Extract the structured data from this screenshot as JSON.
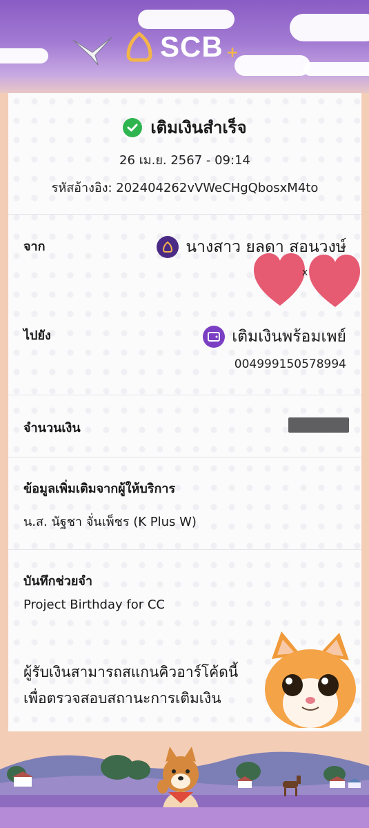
{
  "header": {
    "brand": "SCB",
    "brand_plus": "+"
  },
  "status": {
    "title": "เติมเงินสำเร็จ"
  },
  "datetime": "26 เม.ย. 2567 - 09:14",
  "reference": "รหัสอ้างอิง: 202404262vVWeCHgQbosxM4to",
  "from": {
    "label": "จาก",
    "name": "นางสาว ยลดา สอนวงษ์",
    "heart_separator": "x"
  },
  "to": {
    "label": "ไปยัง",
    "name": "เติมเงินพร้อมเพย์",
    "account": "004999150578994"
  },
  "amount": {
    "label": "จำนวนเงิน"
  },
  "provider": {
    "label": "ข้อมูลเพิ่มเติมจากผู้ให้บริการ",
    "value": "น.ส. นัฐชา จั่นเพ็ชร (K Plus W)"
  },
  "memo": {
    "label": "บันทึกช่วยจำ",
    "value": "Project Birthday for CC"
  },
  "qr_note": {
    "line1": "ผู้รับเงินสามารถสแกนคิวอาร์โค้ดนี้",
    "line2": "เพื่อตรวจสอบสถานะการเติมเงิน"
  },
  "colors": {
    "brand_purple": "#4b2a86",
    "success_green": "#2fb550",
    "sky_purple": "#8a5cc4",
    "heart_red": "#e65a72"
  },
  "icons": [
    "scb-logo-icon",
    "bird-icon",
    "check-circle-icon",
    "bank-icon",
    "wallet-icon",
    "heart-icon",
    "cat-sticker",
    "dog-illustration"
  ]
}
